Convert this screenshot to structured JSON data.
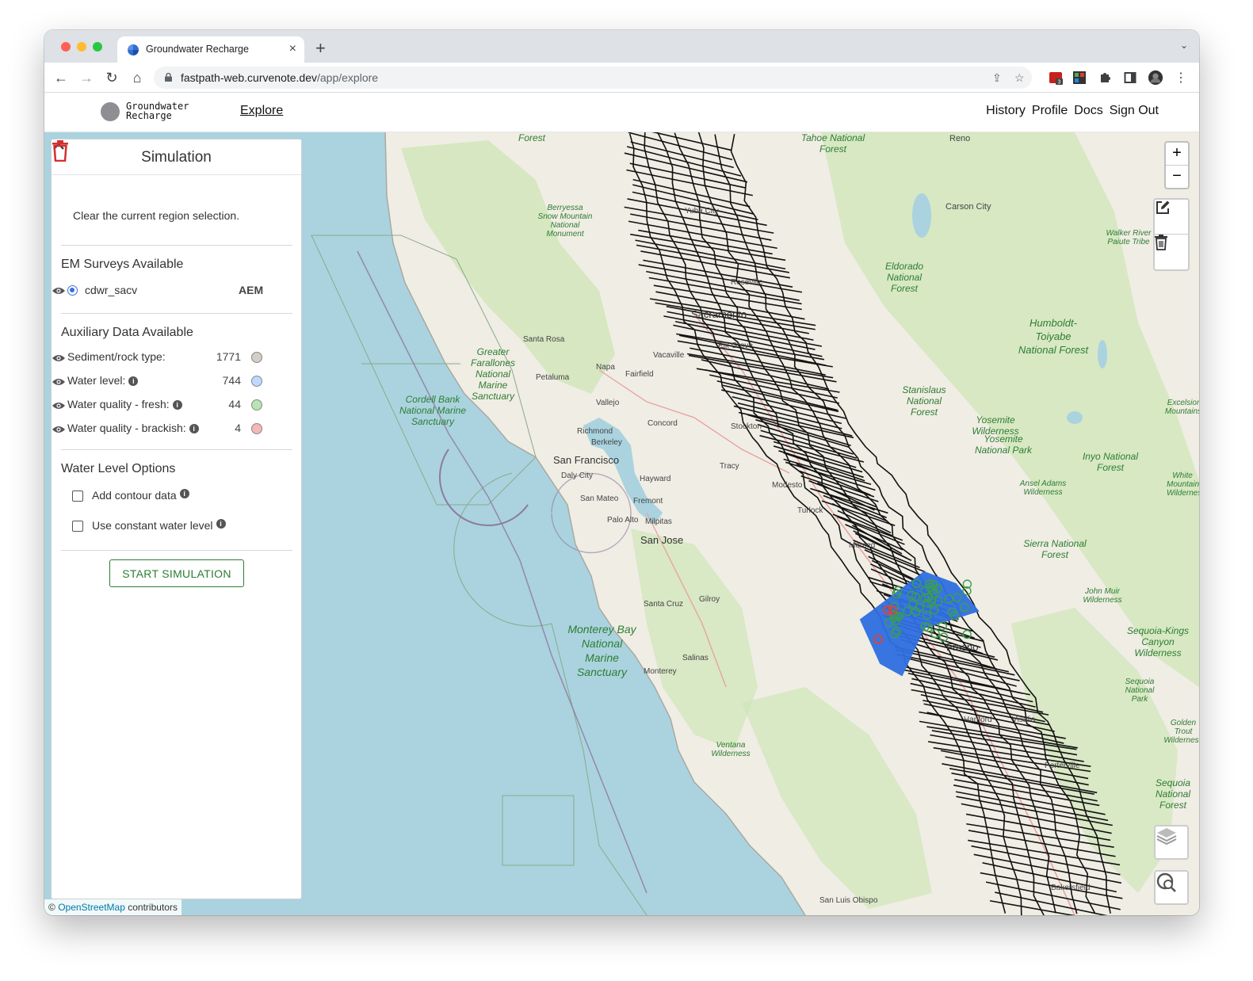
{
  "browser": {
    "tab_title": "Groundwater Recharge",
    "url_host": "fastpath-web.curvenote.dev",
    "url_path": "/app/explore",
    "extension_badge": "3"
  },
  "app": {
    "logo_line1": "Groundwater",
    "logo_line2": "Recharge",
    "explore": "Explore",
    "nav": [
      "History",
      "Profile",
      "Docs",
      "Sign Out"
    ]
  },
  "panel": {
    "title": "Simulation",
    "clear_text": "Clear the current region selection.",
    "em_title": "EM Surveys Available",
    "survey": {
      "name": "cdwr_sacv",
      "type": "AEM"
    },
    "aux_title": "Auxiliary Data Available",
    "aux": [
      {
        "label": "Sediment/rock type:",
        "count": "1771",
        "color": "#d3cec6",
        "info": false
      },
      {
        "label": "Water level:",
        "count": "744",
        "color": "#bcd9ff",
        "info": true
      },
      {
        "label": "Water quality - fresh:",
        "count": "44",
        "color": "#b9e4b4",
        "info": true
      },
      {
        "label": "Water quality - brackish:",
        "count": "4",
        "color": "#f5b7b7",
        "info": true
      }
    ],
    "wl_title": "Water Level Options",
    "option_contour": "Add contour data",
    "option_constant": "Use constant water level",
    "start_button": "START SIMULATION"
  },
  "map": {
    "attribution_prefix": "©",
    "attribution_link": "OpenStreetMap",
    "attribution_suffix": "contributors",
    "cities": [
      "Reno",
      "Carson City",
      "Yuba City",
      "Roseville",
      "Sacramento",
      "Elk Grove",
      "Vacaville",
      "Fairfield",
      "Santa Rosa",
      "Napa",
      "Petaluma",
      "Vallejo",
      "Concord",
      "Richmond",
      "Berkeley",
      "Stockton",
      "Daly City",
      "Hayward",
      "San Mateo",
      "Fremont",
      "Palo Alto",
      "Milpitas",
      "Tracy",
      "Modesto",
      "Turlock",
      "Merced",
      "Santa Cruz",
      "Gilroy",
      "Salinas",
      "Monterey",
      "Hanford",
      "Visalia",
      "Porterville",
      "Bakersfield",
      "San Luis Obispo"
    ],
    "big_cities": [
      "San Francisco",
      "San Jose",
      "Fresno"
    ],
    "parks": [
      "Tahoe National Forest",
      "Eldorado National Forest",
      "Stanislaus National Forest",
      "Yosemite Wilderness",
      "Yosemite National Park",
      "Sierra National Forest",
      "Humboldt-Toiyabe National Forest",
      "Inyo National Forest",
      "Berryessa Snow Mountain National Monument",
      "Ansel Adams Wilderness",
      "John Muir Wilderness",
      "Sequoia-Kings Canyon Wilderness",
      "Sequoia National Park",
      "Sequoia National Forest",
      "Ventana Wilderness",
      "Walker River Paiute Tribe",
      "Excelsior Mountains",
      "Golden Trout Wilderness",
      "White Mountain Wilderness",
      "Forest"
    ],
    "marine": [
      "Cordell Bank National Marine Sanctuary",
      "Greater Farallones National Marine Sanctuary",
      "Monterey Bay National Marine Sanctuary"
    ]
  }
}
